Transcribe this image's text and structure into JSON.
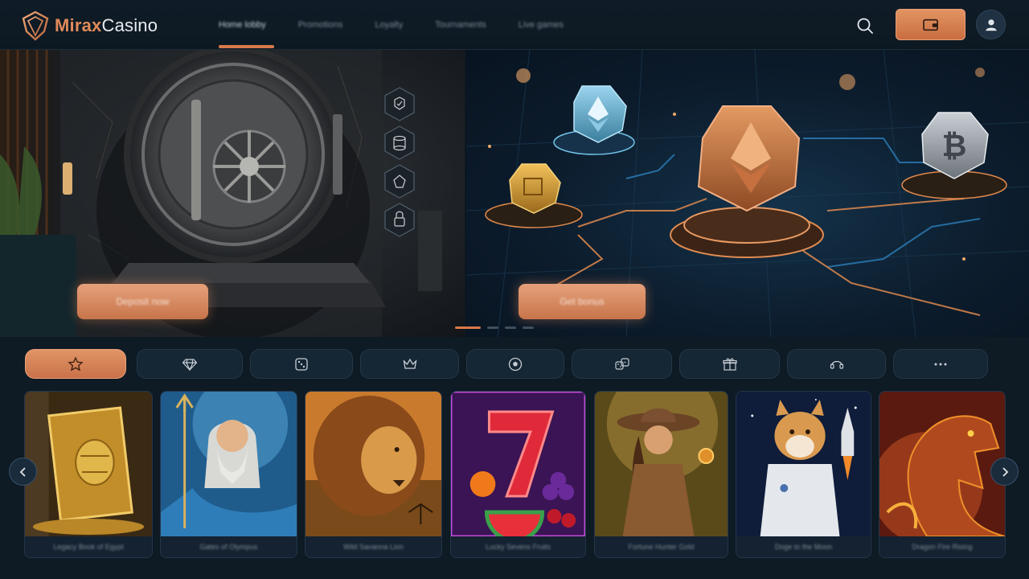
{
  "header": {
    "logo_text_a": "Mirax",
    "logo_text_b": "Casino",
    "nav": [
      {
        "label": "Home lobby"
      },
      {
        "label": "Promotions"
      },
      {
        "label": "Loyalty"
      },
      {
        "label": "Tournaments"
      },
      {
        "label": "Live games"
      }
    ],
    "icons": {
      "search": "search-icon",
      "wallet": "wallet-icon",
      "user": "user-icon"
    }
  },
  "hero": {
    "banners": [
      {
        "cta_label": "Deposit now"
      },
      {
        "cta_label": "Get bonus"
      }
    ],
    "slide_count": 4,
    "active_slide": 1
  },
  "categories": [
    {
      "icon": "star-icon",
      "active": true
    },
    {
      "icon": "diamond-icon"
    },
    {
      "icon": "dice-icon"
    },
    {
      "icon": "crown-icon"
    },
    {
      "icon": "soccer-ball-icon"
    },
    {
      "icon": "dice-pair-icon"
    },
    {
      "icon": "gift-icon"
    },
    {
      "icon": "live-dealer-icon"
    },
    {
      "icon": "more-icon"
    }
  ],
  "games": [
    {
      "name": "Legacy Book of Egypt",
      "theme": "book"
    },
    {
      "name": "Gates of Olympus",
      "theme": "zeus"
    },
    {
      "name": "Wild Savanna Lion",
      "theme": "lion"
    },
    {
      "name": "Lucky Sevens Fruits",
      "theme": "seven"
    },
    {
      "name": "Fortune Hunter Gold",
      "theme": "explorer"
    },
    {
      "name": "Doge to the Moon",
      "theme": "doge"
    },
    {
      "name": "Dragon Fire Rising",
      "theme": "dragon"
    }
  ],
  "colors": {
    "accent": "#d9794a",
    "background": "#0e1a24"
  }
}
